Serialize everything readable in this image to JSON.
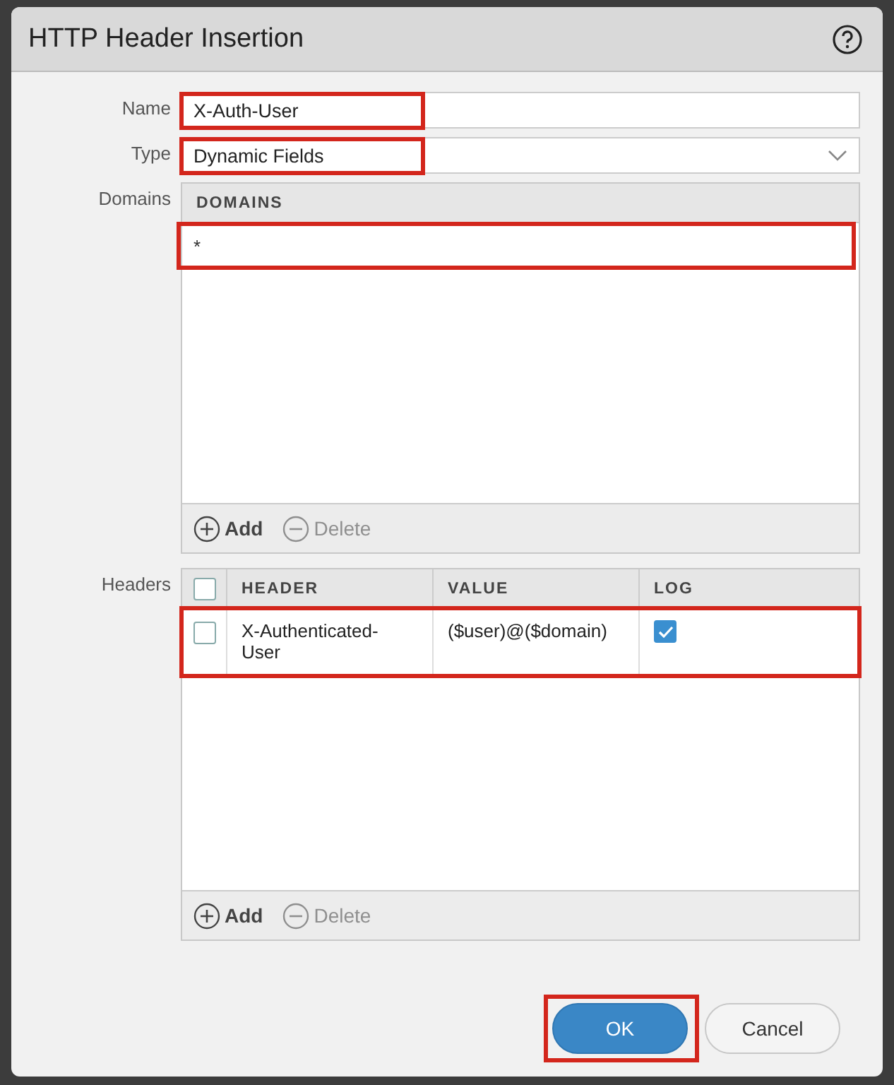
{
  "dialog": {
    "title": "HTTP Header Insertion"
  },
  "fields": [
    {
      "label": "Name",
      "kind": "text",
      "value": "X-Auth-User",
      "highlighted": true
    },
    {
      "label": "Type",
      "kind": "select",
      "value": "Dynamic Fields",
      "highlighted": true
    }
  ],
  "domains": {
    "label": "Domains",
    "columns": [
      "DOMAINS"
    ],
    "rows": [
      {
        "domain": "*",
        "highlighted": true
      }
    ],
    "actions": [
      {
        "label": "Add",
        "kind": "add",
        "disabled": false
      },
      {
        "label": "Delete",
        "kind": "delete",
        "disabled": true
      }
    ]
  },
  "headers": {
    "label": "Headers",
    "all_selected": false,
    "columns": [
      "HEADER",
      "VALUE",
      "LOG"
    ],
    "rows": [
      {
        "header": "X-Authenticated-User",
        "value": "($user)@($domain)",
        "selected": false,
        "log": true,
        "highlighted": true
      }
    ],
    "actions": [
      {
        "label": "Add",
        "kind": "add",
        "disabled": false
      },
      {
        "label": "Delete",
        "kind": "delete",
        "disabled": true
      }
    ]
  },
  "buttons": [
    {
      "label": "OK",
      "primary": true,
      "highlighted": true
    },
    {
      "label": "Cancel",
      "primary": false,
      "highlighted": false
    }
  ]
}
